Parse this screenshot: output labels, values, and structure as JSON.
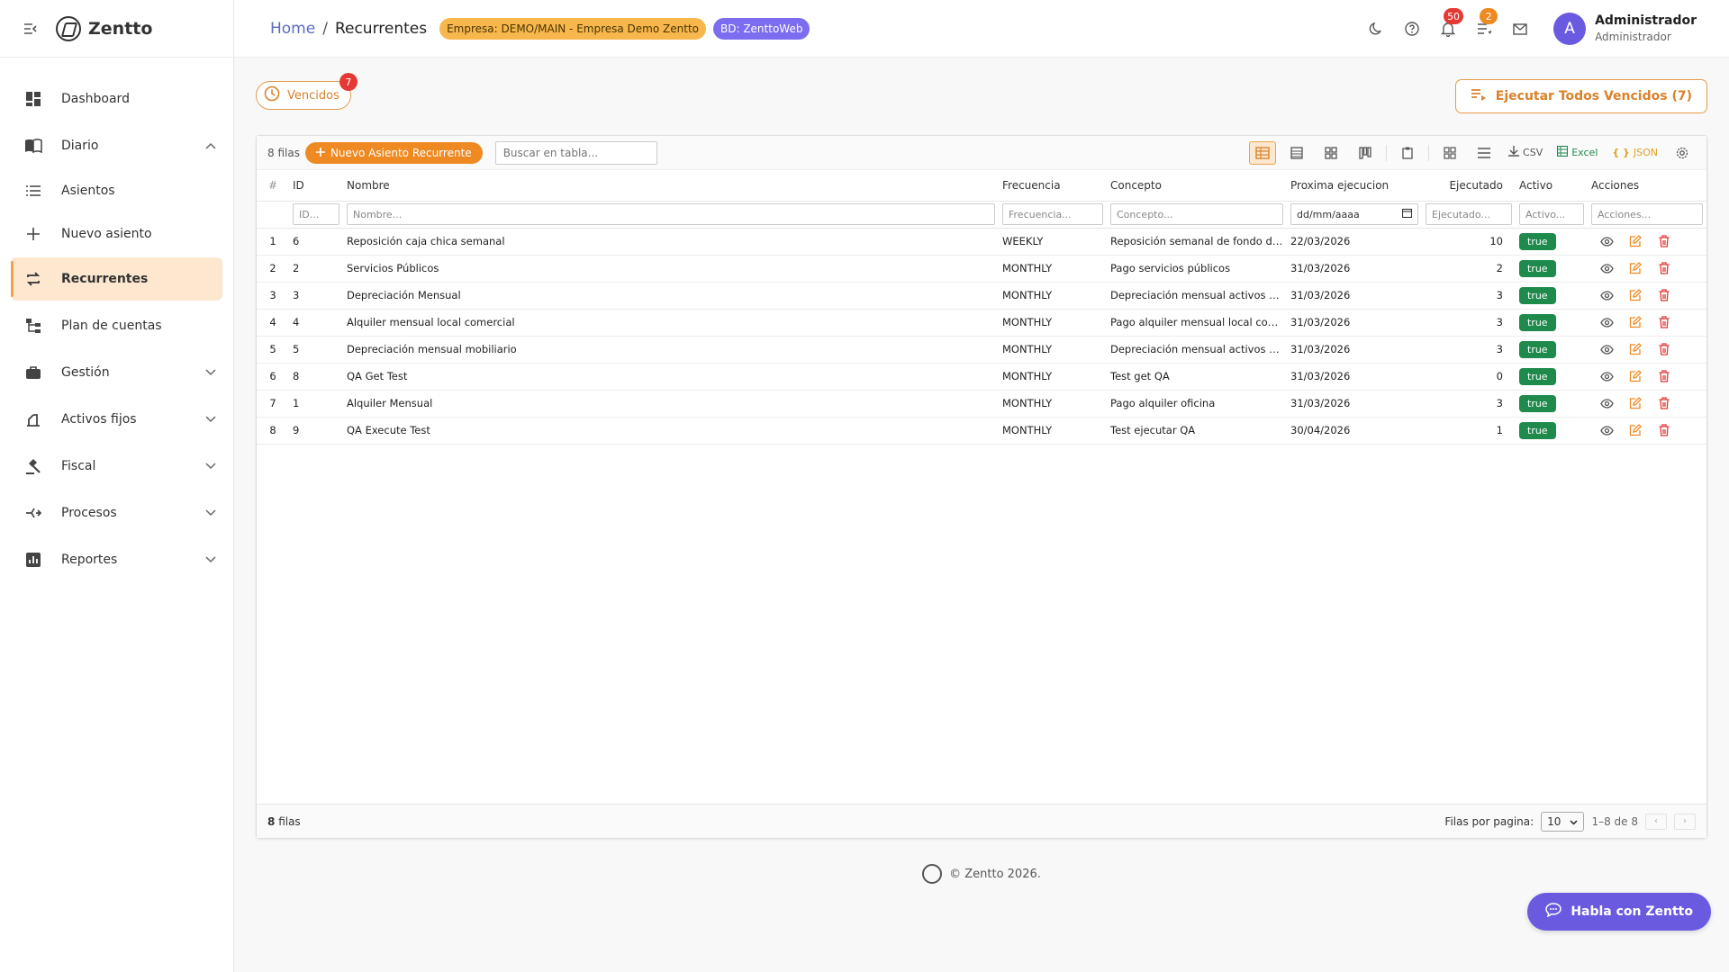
{
  "app": {
    "name": "Zentto"
  },
  "sidebar": {
    "items": [
      {
        "label": "Dashboard",
        "icon": "dashboard-icon"
      },
      {
        "label": "Diario",
        "icon": "book-icon",
        "expanded": true
      },
      {
        "label": "Asientos",
        "icon": "list-icon"
      },
      {
        "label": "Nuevo asiento",
        "icon": "plus-icon"
      },
      {
        "label": "Recurrentes",
        "icon": "repeat-icon",
        "active": true
      },
      {
        "label": "Plan de cuentas",
        "icon": "tree-icon"
      },
      {
        "label": "Gestión",
        "icon": "briefcase-icon"
      },
      {
        "label": "Activos fijos",
        "icon": "asset-icon"
      },
      {
        "label": "Fiscal",
        "icon": "gavel-icon"
      },
      {
        "label": "Procesos",
        "icon": "process-icon"
      },
      {
        "label": "Reportes",
        "icon": "report-icon"
      }
    ]
  },
  "header": {
    "breadcrumb_home": "Home",
    "breadcrumb_sep": "/",
    "breadcrumb_current": "Recurrentes",
    "company_chip": "Empresa: DEMO/MAIN - Empresa Demo Zentto",
    "db_chip": "BD: ZenttoWeb",
    "notifications_count": "50",
    "tasks_count": "2",
    "user_initial": "A",
    "user_name": "Administrador",
    "user_role": "Administrador"
  },
  "toolbar": {
    "vencidos_label": "Vencidos",
    "vencidos_count": "7",
    "execute_all_label": "Ejecutar Todos Vencidos (7)"
  },
  "grid": {
    "row_count_label": "8 filas",
    "new_button_label": "Nuevo Asiento Recurrente",
    "search_placeholder": "Buscar en tabla...",
    "csv_label": "CSV",
    "excel_label": "Excel",
    "json_label": "JSON",
    "columns": {
      "num": "#",
      "id": "ID",
      "nombre": "Nombre",
      "frecuencia": "Frecuencia",
      "concepto": "Concepto",
      "proxima": "Proxima ejecucion",
      "ejecutado": "Ejecutado",
      "activo": "Activo",
      "acciones": "Acciones"
    },
    "filters": {
      "id": "ID...",
      "nombre": "Nombre...",
      "frecuencia": "Frecuencia...",
      "concepto": "Concepto...",
      "proxima": "dd/mm/aaaa",
      "ejecutado": "Ejecutado...",
      "activo": "Activo...",
      "acciones": "Acciones..."
    },
    "rows": [
      {
        "num": "1",
        "id": "6",
        "nombre": "Reposición caja chica semanal",
        "frecuencia": "WEEKLY",
        "concepto": "Reposición semanal de fondo de caja chica",
        "proxima": "22/03/2026",
        "ejecutado": "10",
        "activo": "true"
      },
      {
        "num": "2",
        "id": "2",
        "nombre": "Servicios Públicos",
        "frecuencia": "MONTHLY",
        "concepto": "Pago servicios públicos",
        "proxima": "31/03/2026",
        "ejecutado": "2",
        "activo": "true"
      },
      {
        "num": "3",
        "id": "3",
        "nombre": "Depreciación Mensual",
        "frecuencia": "MONTHLY",
        "concepto": "Depreciación mensual activos fijos",
        "proxima": "31/03/2026",
        "ejecutado": "3",
        "activo": "true"
      },
      {
        "num": "4",
        "id": "4",
        "nombre": "Alquiler mensual local comercial",
        "frecuencia": "MONTHLY",
        "concepto": "Pago alquiler mensual local comercial",
        "proxima": "31/03/2026",
        "ejecutado": "3",
        "activo": "true"
      },
      {
        "num": "5",
        "id": "5",
        "nombre": "Depreciación mensual mobiliario",
        "frecuencia": "MONTHLY",
        "concepto": "Depreciación mensual activos fijos mobiliario",
        "proxima": "31/03/2026",
        "ejecutado": "3",
        "activo": "true"
      },
      {
        "num": "6",
        "id": "8",
        "nombre": "QA Get Test",
        "frecuencia": "MONTHLY",
        "concepto": "Test get QA",
        "proxima": "31/03/2026",
        "ejecutado": "0",
        "activo": "true"
      },
      {
        "num": "7",
        "id": "1",
        "nombre": "Alquiler Mensual",
        "frecuencia": "MONTHLY",
        "concepto": "Pago alquiler oficina",
        "proxima": "31/03/2026",
        "ejecutado": "3",
        "activo": "true"
      },
      {
        "num": "8",
        "id": "9",
        "nombre": "QA Execute Test",
        "frecuencia": "MONTHLY",
        "concepto": "Test ejecutar QA",
        "proxima": "30/04/2026",
        "ejecutado": "1",
        "activo": "true"
      }
    ],
    "footer": {
      "count_number": "8",
      "count_suffix": "filas",
      "rows_per_page_label": "Filas por pagina:",
      "rows_per_page_value": "10",
      "range_label": "1–8 de 8"
    }
  },
  "footer": {
    "copyright": "© Zentto 2026."
  },
  "chat": {
    "label": "Habla con Zentto"
  },
  "colors": {
    "accent": "#ef8a23",
    "primary": "#6a5ae0",
    "success": "#1e8a4c",
    "danger": "#e53935",
    "link": "#5c6bc0"
  }
}
